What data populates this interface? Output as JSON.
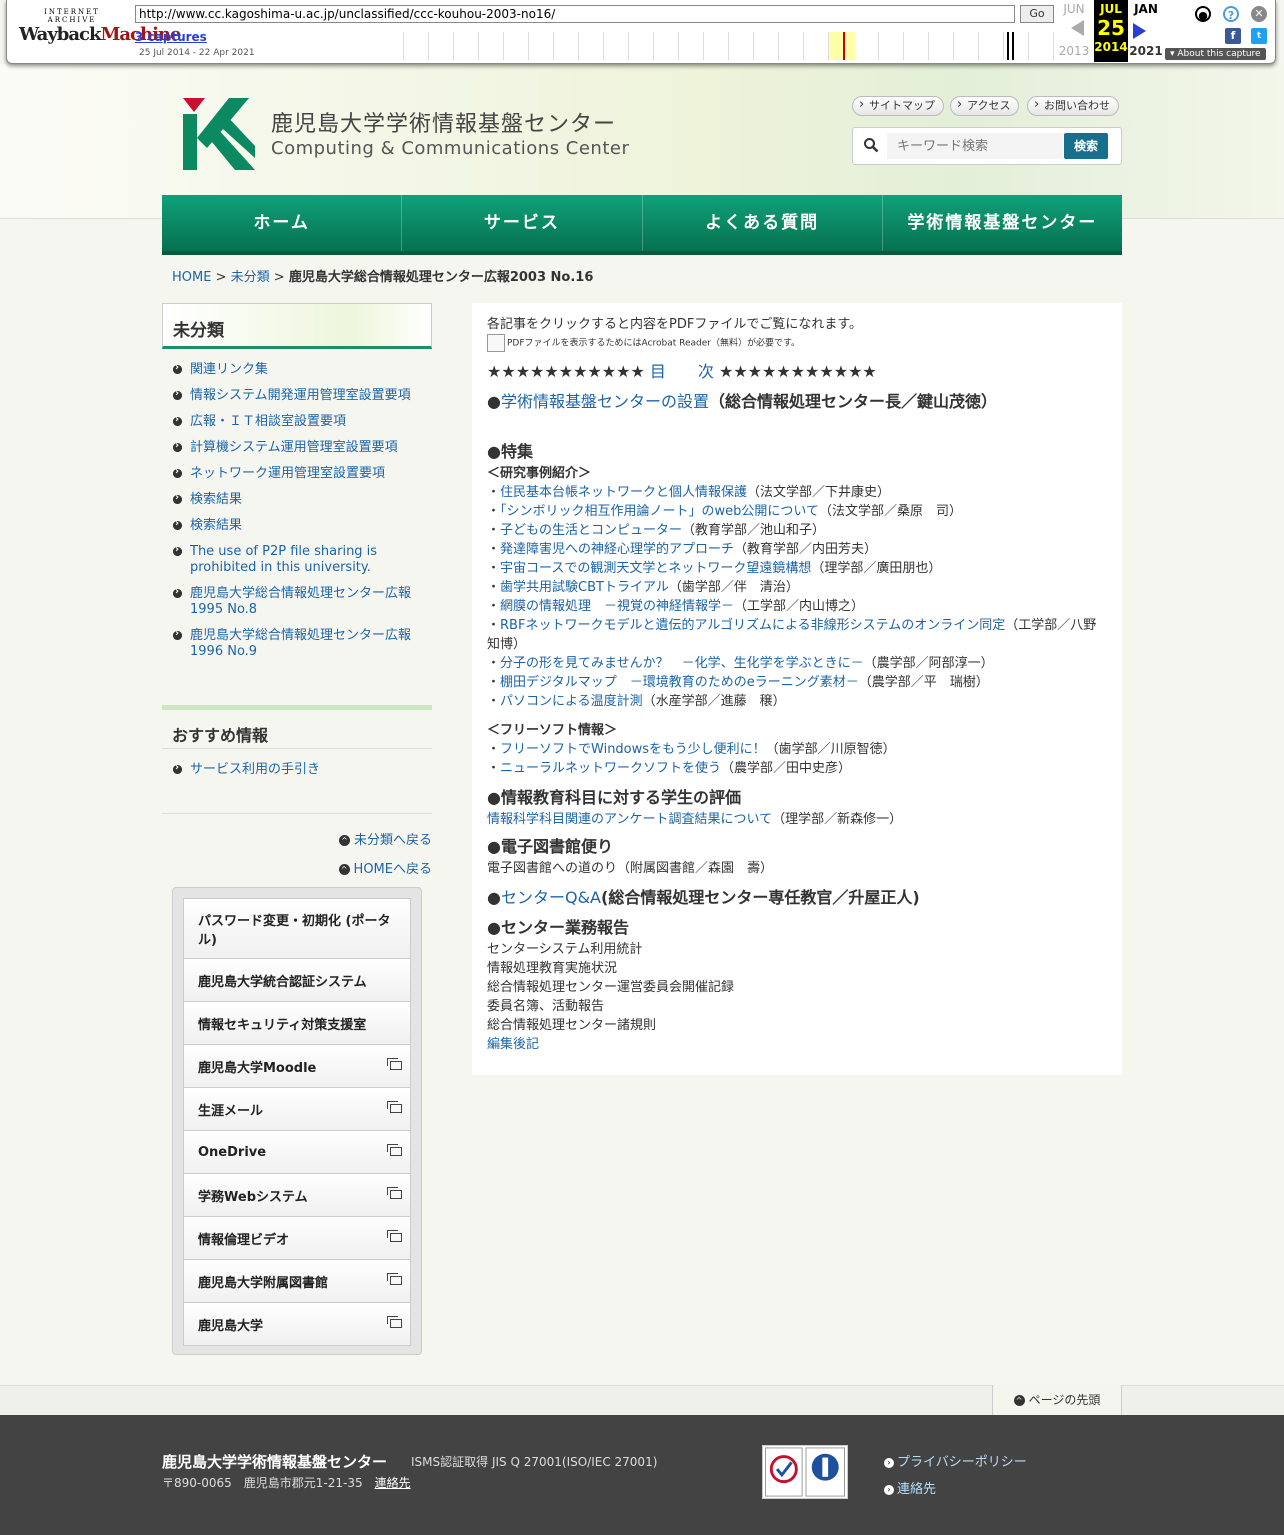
{
  "wayback": {
    "logo_top": "INTERNET ARCHIVE",
    "logo_main_1": "Wayback",
    "logo_main_2": "Machine",
    "url": "http://www.cc.kagoshima-u.ac.jp/unclassified/ccc-kouhou-2003-no16/",
    "go_label": "Go",
    "captures": "3 captures",
    "range": "25 Jul 2014 - 22 Apr 2021",
    "prev_month": "JUN",
    "cur_month": "JUL",
    "cur_day": "25",
    "next_month": "JAN",
    "prev_year": "2013",
    "cur_year": "2014",
    "next_year": "2021",
    "about": "About this capture"
  },
  "header": {
    "title_ja": "鹿児島大学学術情報基盤センター",
    "title_en": "Computing & Communications Center",
    "links": [
      "サイトマップ",
      "アクセス",
      "お問い合わせ"
    ],
    "search_placeholder": "キーワード検索",
    "search_button": "検索"
  },
  "nav": [
    "ホーム",
    "サービス",
    "よくある質問",
    "学術情報基盤センター"
  ],
  "breadcrumb": {
    "home": "HOME",
    "sep": ">",
    "cat": "未分類",
    "current": "鹿児島大学総合情報処理センター広報2003 No.16"
  },
  "sidebar": {
    "category_title": "未分類",
    "items": [
      "関連リンク集",
      "情報システム開発運用管理室設置要項",
      "広報・ＩＴ相談室設置要項",
      "計算機システム運用管理室設置要項",
      "ネットワーク運用管理室設置要項",
      "検索結果",
      "検索結果",
      "The use of P2P file sharing is prohibited in this university.",
      "鹿児島大学総合情報処理センター広報1995 No.8",
      "鹿児島大学総合情報処理センター広報1996 No.9"
    ],
    "rec_title": "おすすめ情報",
    "rec_items": [
      "サービス利用の手引き"
    ],
    "back_cat": "未分類へ戻る",
    "back_home": "HOMEへ戻る",
    "banners": [
      "パスワード変更・初期化 (ポータル)",
      "鹿児島大学統合認証システム",
      "情報セキュリティ対策支援室",
      "鹿児島大学Moodle",
      "生涯メール",
      "OneDrive",
      "学務Webシステム",
      "情報倫理ビデオ",
      "鹿児島大学附属図書館",
      "鹿児島大学"
    ]
  },
  "main": {
    "intro": "各記事をクリックすると内容をPDFファイルでご覧になれます。",
    "pdf_note": "PDFファイルを表示するためにはAcrobat Reader（無料）が必要です。",
    "toc_stars_l": "★★★★★★★★★★★",
    "toc_label": "目　　次",
    "toc_stars_r": "★★★★★★★★★★★",
    "s1_link": "学術情報基盤センターの設置",
    "s1_author": "（総合情報処理センター長／鍵山茂徳）",
    "s2_title": "●特集",
    "s2_sub": "＜研究事例紹介＞",
    "articles": [
      {
        "link": "住民基本台帳ネットワークと個人情報保護",
        "author": "（法文学部／下井康史）"
      },
      {
        "link": "「シンボリック相互作用論ノート」のweb公開について",
        "author": "（法文学部／桑原　司）"
      },
      {
        "link": "子どもの生活とコンピューター",
        "author": "（教育学部／池山和子）"
      },
      {
        "link": "発達障害児への神経心理学的アプローチ",
        "author": "（教育学部／内田芳夫）"
      },
      {
        "link": "宇宙コースでの観測天文学とネットワーク望遠鏡構想",
        "author": "（理学部／廣田朋也）"
      },
      {
        "link": "歯学共用試験CBTトライアル",
        "author": "（歯学部／伴　清治）"
      },
      {
        "link": "網膜の情報処理　－視覚の神経情報学－",
        "author": "（工学部／内山博之）"
      },
      {
        "link": "RBFネットワークモデルと遺伝的アルゴリズムによる非線形システムのオンライン同定",
        "author": "（工学部／八野知博）"
      },
      {
        "link": "分子の形を見てみませんか？　－化学、生化学を学ぶときに－",
        "author": "（農学部／阿部淳一）"
      },
      {
        "link": "棚田デジタルマップ　－環境教育のためのeラーニング素材－",
        "author": "（農学部／平　瑞樹）"
      },
      {
        "link": "パソコンによる温度計測",
        "author": "（水産学部／進藤　穣）"
      }
    ],
    "free_sub": "＜フリーソフト情報＞",
    "free": [
      {
        "link": "フリーソフトでWindowsをもう少し便利に！",
        "author": "（歯学部／川原智徳）"
      },
      {
        "link": "ニューラルネットワークソフトを使う",
        "author": "（農学部／田中史彦）"
      }
    ],
    "s3_title": "●情報教育科目に対する学生の評価",
    "s3_link": "情報科学科目関連のアンケート調査結果について",
    "s3_author": "（理学部／新森修一）",
    "s4_title": "●電子図書館便り",
    "s4_text": "電子図書館への道のり（附属図書館／森園　壽）",
    "s5_link": "センターQ&A",
    "s5_author": "(総合情報処理センター専任教官／升屋正人)",
    "s6_title": "●センター業務報告",
    "s6_items": [
      "センターシステム利用統計",
      "情報処理教育実施状況",
      "総合情報処理センター運営委員会開催記録",
      "委員名簿、活動報告",
      "総合情報処理センター諸規則"
    ],
    "s6_link": "編集後記"
  },
  "footer": {
    "totop": "ページの先頭",
    "name": "鹿児島大学学術情報基盤センター",
    "isms": "ISMS認証取得 JIS Q 27001(ISO/IEC 27001)",
    "addr": "〒890-0065　鹿児島市郡元1-21-35",
    "contact": "連絡先",
    "links": [
      "プライバシーポリシー",
      "連絡先"
    ]
  },
  "colors": {
    "accent": "#0b8a62",
    "link": "#1c64a8"
  }
}
